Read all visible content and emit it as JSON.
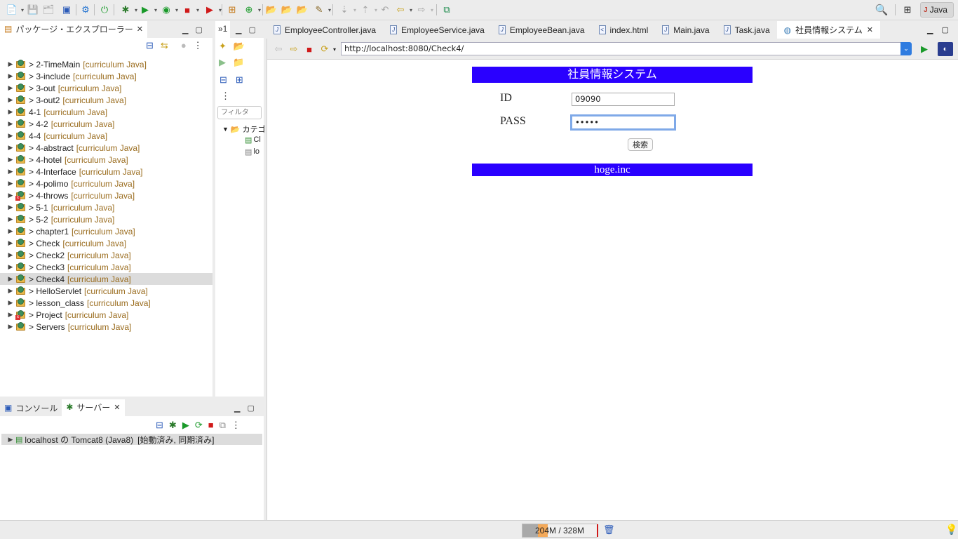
{
  "toolbar": {
    "perspective_label": "Java"
  },
  "package_explorer": {
    "title": "パッケージ・エクスプローラー",
    "items": [
      {
        "label": "> 2-TimeMain",
        "lib": "[curriculum Java]",
        "error": false
      },
      {
        "label": "> 3-include",
        "lib": "[curriculum Java]",
        "error": false
      },
      {
        "label": "> 3-out",
        "lib": "[curriculum Java]",
        "error": false
      },
      {
        "label": "> 3-out2",
        "lib": "[curriculum Java]",
        "error": false
      },
      {
        "label": "4-1",
        "lib": "[curriculum Java]",
        "error": false
      },
      {
        "label": "> 4-2",
        "lib": "[curriculum Java]",
        "error": false
      },
      {
        "label": "4-4",
        "lib": "[curriculum Java]",
        "error": false
      },
      {
        "label": "> 4-abstract",
        "lib": "[curriculum Java]",
        "error": false
      },
      {
        "label": "> 4-hotel",
        "lib": "[curriculum Java]",
        "error": false
      },
      {
        "label": "> 4-Interface",
        "lib": "[curriculum Java]",
        "error": false
      },
      {
        "label": "> 4-polimo",
        "lib": "[curriculum Java]",
        "error": false
      },
      {
        "label": "> 4-throws",
        "lib": "[curriculum Java]",
        "error": true
      },
      {
        "label": "> 5-1",
        "lib": "[curriculum Java]",
        "error": false
      },
      {
        "label": "> 5-2",
        "lib": "[curriculum Java]",
        "error": false
      },
      {
        "label": "> chapter1",
        "lib": "[curriculum Java]",
        "error": false
      },
      {
        "label": "> Check",
        "lib": "[curriculum Java]",
        "error": false
      },
      {
        "label": "> Check2",
        "lib": "[curriculum Java]",
        "error": false
      },
      {
        "label": "> Check3",
        "lib": "[curriculum Java]",
        "error": false
      },
      {
        "label": "> Check4",
        "lib": "[curriculum Java]",
        "error": false
      },
      {
        "label": "> HelloServlet",
        "lib": "[curriculum Java]",
        "error": false
      },
      {
        "label": "> lesson_class",
        "lib": "[curriculum Java]",
        "error": false
      },
      {
        "label": "> Project",
        "lib": "[curriculum Java]",
        "error": true
      },
      {
        "label": "> Servers",
        "lib": "[curriculum Java]",
        "error": false
      }
    ],
    "selected_index": 18
  },
  "outline": {
    "tab_label": "»1",
    "filter_placeholder": "フィルタ",
    "tree_root": "カテゴ",
    "tree_child1": "Cl",
    "tree_child2": "lo"
  },
  "bottom_panel": {
    "console_tab": "コンソール",
    "servers_tab": "サーバー",
    "server_item": "localhost の Tomcat8 (Java8)",
    "server_status": "[始動済み, 同期済み]"
  },
  "editor_tabs": [
    {
      "label": "EmployeeController.java",
      "icon": "J"
    },
    {
      "label": "EmployeeService.java",
      "icon": "J"
    },
    {
      "label": "EmployeeBean.java",
      "icon": "J"
    },
    {
      "label": "index.html",
      "icon": "html"
    },
    {
      "label": "Main.java",
      "icon": "J"
    },
    {
      "label": "Task.java",
      "icon": "J"
    },
    {
      "label": "社員情報システム",
      "icon": "globe",
      "active": true
    }
  ],
  "browser": {
    "url": "http://localhost:8080/Check4/"
  },
  "webpage": {
    "title": "社員情報システム",
    "id_label": "ID",
    "id_value": "09090",
    "pass_label": "PASS",
    "pass_value": "•••••",
    "search_button": "検索",
    "footer": "hoge.inc"
  },
  "status_bar": {
    "heap": "204M / 328M"
  },
  "colors": {
    "banner": "#2a00ff",
    "library_text": "#9a6c1e"
  }
}
